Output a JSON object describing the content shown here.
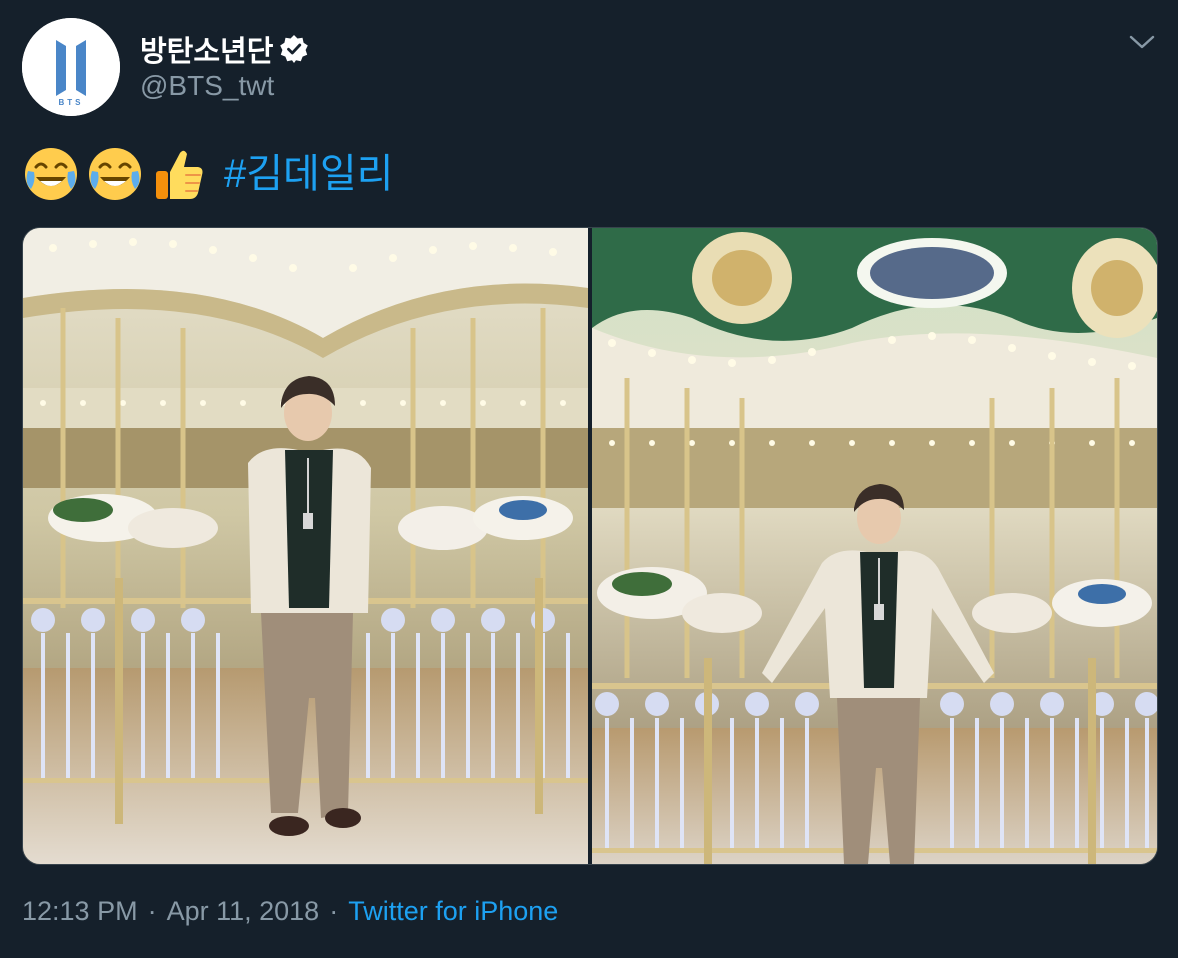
{
  "author": {
    "display_name": "방탄소년단",
    "handle": "@BTS_twt",
    "verified": true,
    "avatar_text": "BTS"
  },
  "tweet": {
    "emojis": [
      "face-with-tears-of-joy",
      "face-with-tears-of-joy",
      "thumbs-up"
    ],
    "hashtag": "#김데일리"
  },
  "media": {
    "photo_count": 2
  },
  "meta": {
    "time": "12:13 PM",
    "date": "Apr 11, 2018",
    "separator": "·",
    "source": "Twitter for iPhone"
  },
  "colors": {
    "background": "#15202b",
    "link": "#1da1f2",
    "secondary_text": "#8899a6",
    "border": "#38444d",
    "brand_blue": "#4a86c8"
  }
}
